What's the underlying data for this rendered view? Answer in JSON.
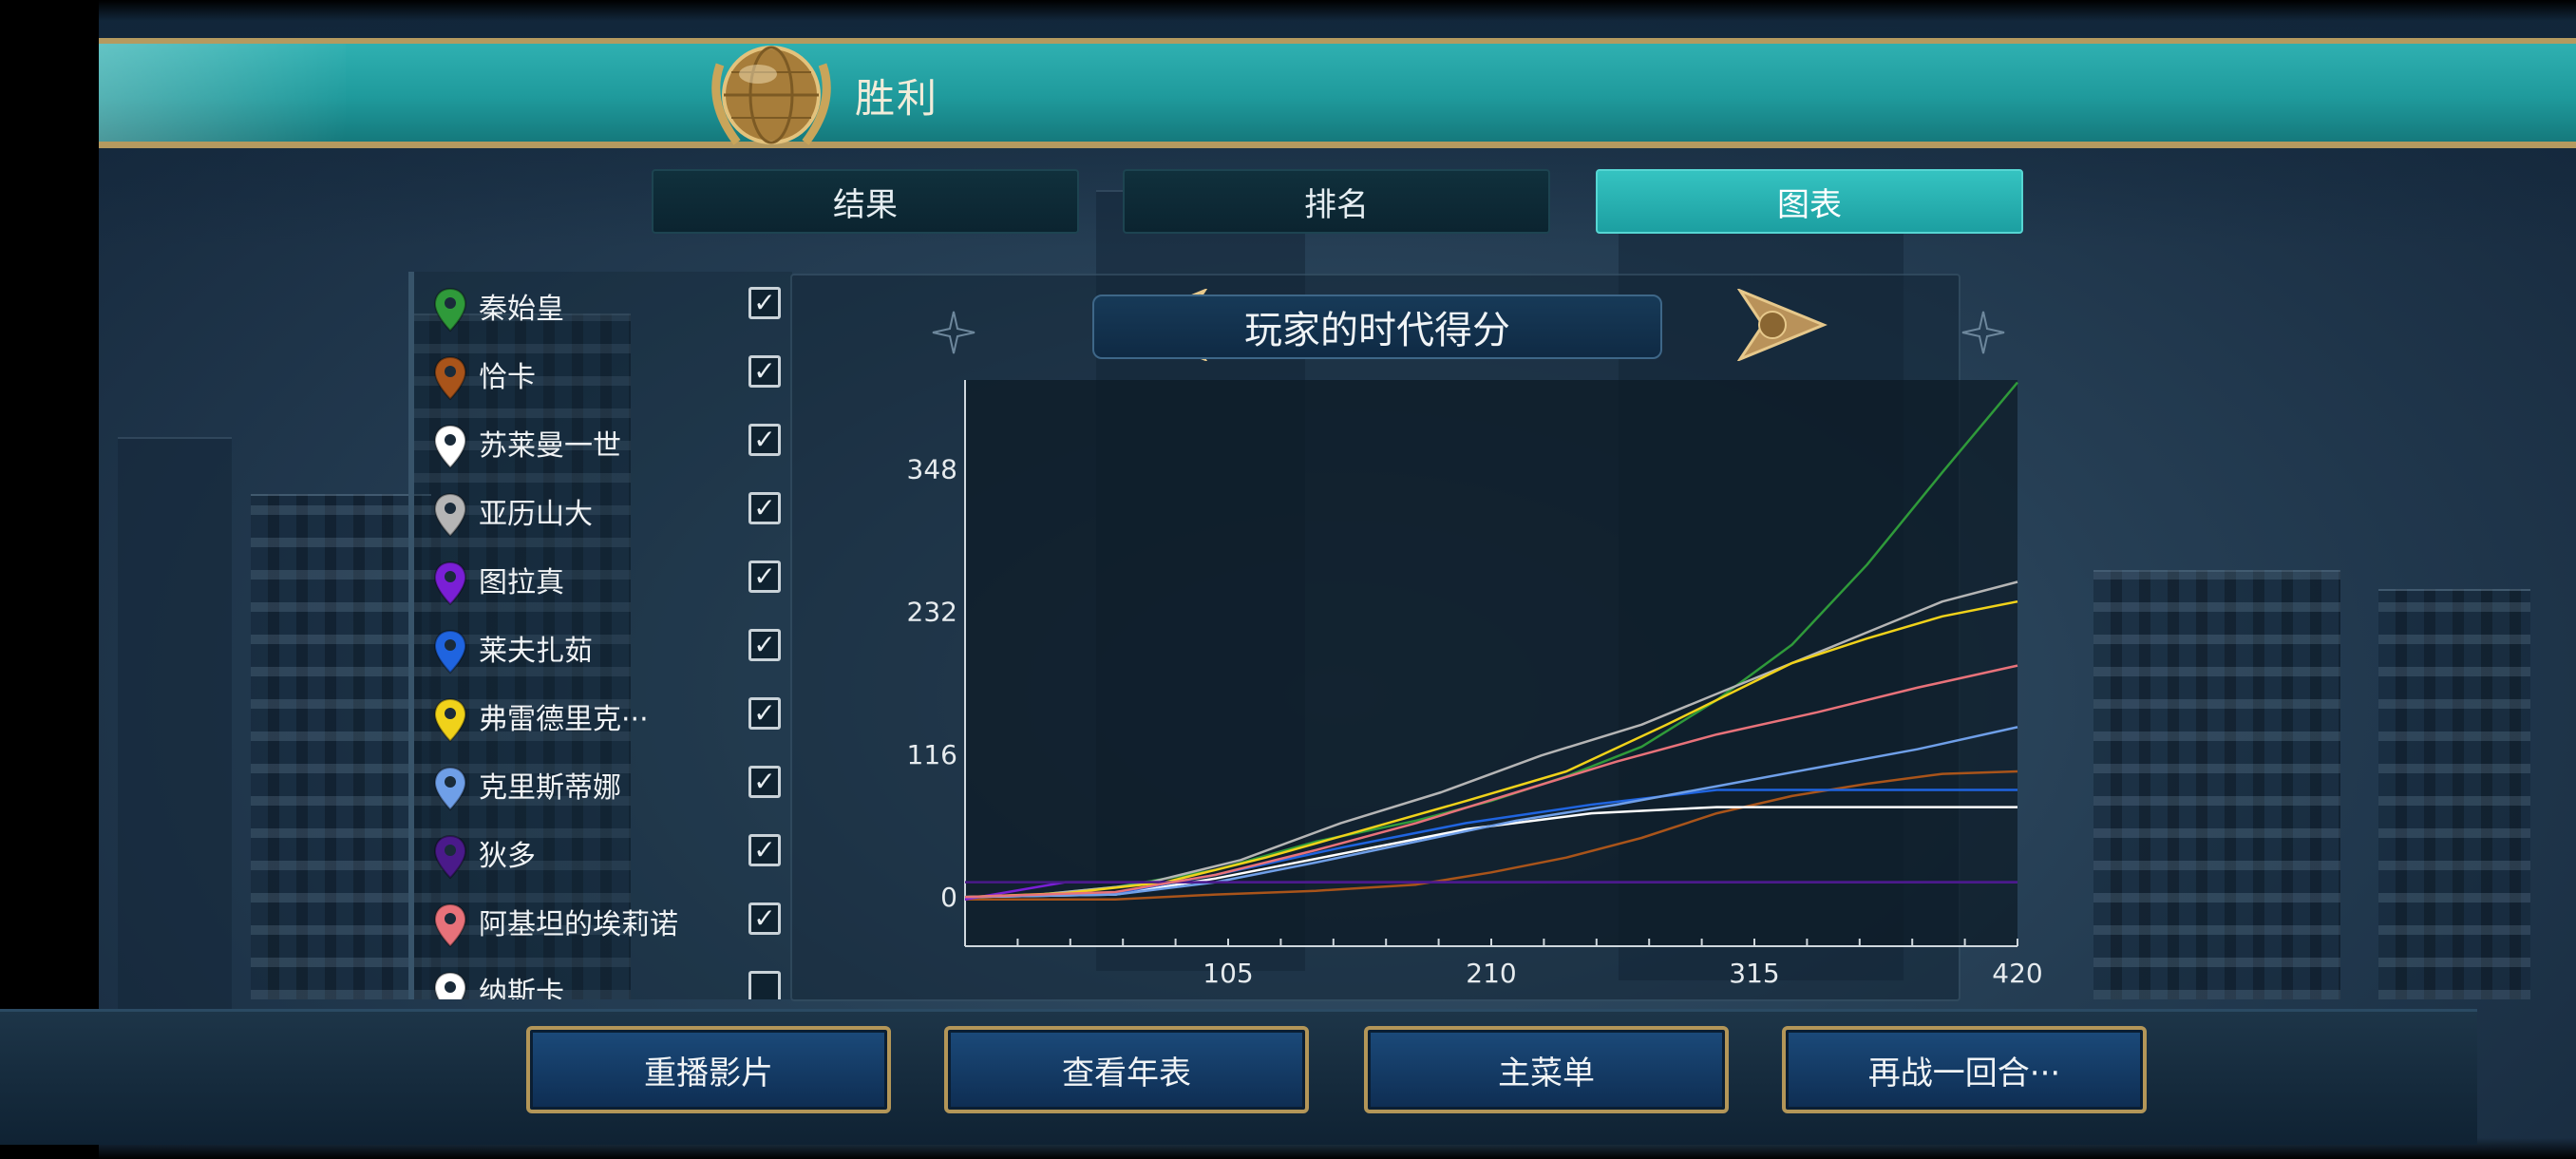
{
  "header": {
    "title": "胜利",
    "emblem_icon": "globe-laurel-icon"
  },
  "tabs": [
    {
      "label": "结果",
      "active": false
    },
    {
      "label": "排名",
      "active": false
    },
    {
      "label": "图表",
      "active": true
    }
  ],
  "players": [
    {
      "name": "秦始皇",
      "color": "#2f9a3a",
      "checked": true,
      "check": "✓"
    },
    {
      "name": "恰卡",
      "color": "#a9541a",
      "checked": true,
      "check": "✓"
    },
    {
      "name": "苏莱曼一世",
      "color": "#ffffff",
      "checked": true,
      "check": "✓"
    },
    {
      "name": "亚历山大",
      "color": "#b5b5b5",
      "checked": true,
      "check": "✓"
    },
    {
      "name": "图拉真",
      "color": "#7a1fd6",
      "checked": true,
      "check": "✓"
    },
    {
      "name": "莱夫扎茹",
      "color": "#1f64e0",
      "checked": true,
      "check": "✓"
    },
    {
      "name": "弗雷德里克···",
      "color": "#f0d21a",
      "checked": true,
      "check": "✓"
    },
    {
      "name": "克里斯蒂娜",
      "color": "#6f9fe8",
      "checked": true,
      "check": "✓"
    },
    {
      "name": "狄多",
      "color": "#4a1a8a",
      "checked": true,
      "check": "✓"
    },
    {
      "name": "阿基坦的埃莉诺",
      "color": "#e8727a",
      "checked": true,
      "check": "✓"
    },
    {
      "name": "纳斯卡",
      "color": "#ffffff",
      "checked": false,
      "check": ""
    }
  ],
  "chart_title": "玩家的时代得分",
  "chart_data": {
    "type": "line",
    "title": "玩家的时代得分",
    "xlabel": "",
    "ylabel": "",
    "x_ticks": [
      105,
      210,
      315,
      420
    ],
    "y_ticks": [
      0,
      116,
      232,
      348
    ],
    "xlim": [
      0,
      420
    ],
    "ylim": [
      -40,
      420
    ],
    "grid": false,
    "series": [
      {
        "name": "秦始皇",
        "color": "#2f9a3a",
        "x": [
          0,
          30,
          60,
          100,
          140,
          180,
          210,
          240,
          270,
          300,
          330,
          360,
          390,
          420
        ],
        "y": [
          0,
          2,
          8,
          22,
          45,
          62,
          78,
          98,
          122,
          160,
          205,
          270,
          345,
          418
        ]
      },
      {
        "name": "恰卡",
        "color": "#a9541a",
        "x": [
          0,
          60,
          100,
          140,
          180,
          210,
          240,
          270,
          300,
          330,
          360,
          390,
          420
        ],
        "y": [
          -2,
          -2,
          2,
          5,
          10,
          20,
          32,
          48,
          68,
          82,
          92,
          100,
          102
        ]
      },
      {
        "name": "苏莱曼一世",
        "color": "#ffffff",
        "x": [
          0,
          60,
          100,
          150,
          200,
          250,
          300,
          420
        ],
        "y": [
          0,
          2,
          15,
          35,
          55,
          68,
          73,
          73
        ]
      },
      {
        "name": "亚历山大",
        "color": "#b5b5b5",
        "x": [
          0,
          30,
          70,
          110,
          150,
          190,
          230,
          270,
          300,
          330,
          360,
          390,
          420
        ],
        "y": [
          0,
          2,
          10,
          30,
          60,
          85,
          115,
          140,
          165,
          190,
          215,
          240,
          256
        ]
      },
      {
        "name": "图拉真",
        "color": "#7a1fd6",
        "x": [
          0,
          40,
          420
        ],
        "y": [
          -2,
          12,
          12
        ]
      },
      {
        "name": "莱夫扎茹",
        "color": "#1f64e0",
        "x": [
          0,
          60,
          100,
          150,
          200,
          250,
          300,
          420
        ],
        "y": [
          0,
          3,
          18,
          40,
          60,
          75,
          87,
          87
        ]
      },
      {
        "name": "弗雷德里克···",
        "color": "#f0d21a",
        "x": [
          0,
          40,
          80,
          120,
          160,
          200,
          240,
          280,
          300,
          330,
          360,
          390,
          420
        ],
        "y": [
          0,
          3,
          12,
          32,
          55,
          78,
          102,
          140,
          160,
          190,
          210,
          228,
          240
        ]
      },
      {
        "name": "克里斯蒂娜",
        "color": "#6f9fe8",
        "x": [
          0,
          60,
          100,
          140,
          180,
          220,
          260,
          300,
          340,
          380,
          420
        ],
        "y": [
          0,
          2,
          12,
          28,
          45,
          62,
          75,
          90,
          105,
          120,
          138
        ]
      },
      {
        "name": "狄多",
        "color": "#4a1a8a",
        "x": [
          0,
          420
        ],
        "y": [
          12,
          12
        ]
      },
      {
        "name": "阿基坦的埃莉诺",
        "color": "#e8727a",
        "x": [
          0,
          60,
          100,
          140,
          180,
          220,
          260,
          300,
          340,
          380,
          420
        ],
        "y": [
          0,
          4,
          18,
          38,
          60,
          85,
          110,
          132,
          150,
          170,
          188
        ]
      }
    ]
  },
  "buttons": [
    {
      "label": "重播影片"
    },
    {
      "label": "查看年表"
    },
    {
      "label": "主菜单"
    },
    {
      "label": "再战一回合···"
    }
  ]
}
